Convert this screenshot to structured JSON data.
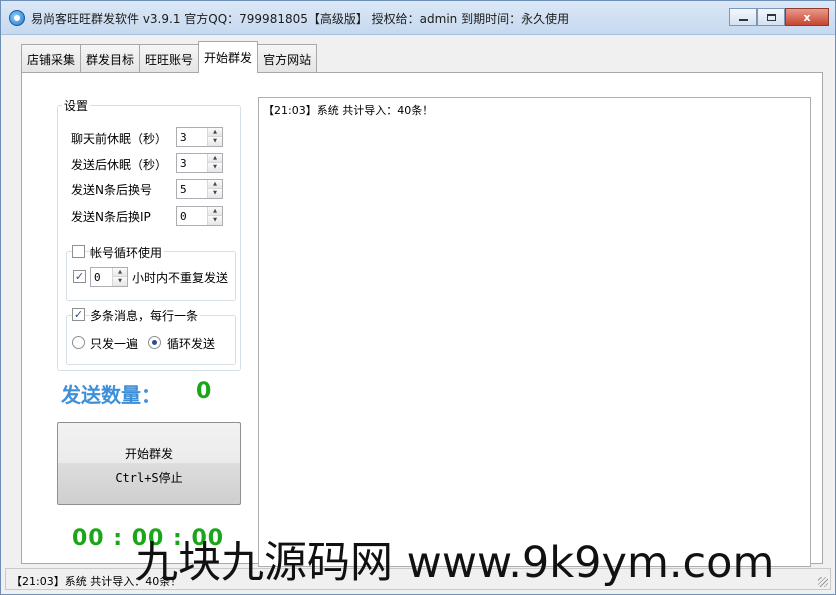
{
  "window": {
    "title": "易尚客旺旺群发软件 v3.9.1 官方QQ：799981805【高级版】 授权给：admin  到期时间：永久使用",
    "buttons": {
      "close": "x"
    }
  },
  "tabs": [
    {
      "label": "店铺采集"
    },
    {
      "label": "群发目标"
    },
    {
      "label": "旺旺账号"
    },
    {
      "label": "开始群发"
    },
    {
      "label": "官方网站"
    }
  ],
  "settings": {
    "title": "设置",
    "fields": [
      {
        "label": "聊天前休眠（秒）",
        "value": "3"
      },
      {
        "label": "发送后休眠（秒）",
        "value": "3"
      },
      {
        "label": "发送N条后换号",
        "value": "5"
      },
      {
        "label": "发送N条后换IP",
        "value": "0"
      }
    ],
    "account_loop": {
      "label": "帐号循环使用",
      "checked": false,
      "no_repeat": {
        "checked": true,
        "hours": "0",
        "label": "小时内不重复发送"
      }
    },
    "multi_message": {
      "label": "多条消息，每行一条",
      "checked": true,
      "options": [
        {
          "label": "只发一遍",
          "selected": false
        },
        {
          "label": "循环发送",
          "selected": true
        }
      ]
    }
  },
  "counter": {
    "label": "发送数量：",
    "value": "0"
  },
  "start_button": {
    "line1": "开始群发",
    "line2": "Ctrl+S停止"
  },
  "timer": "00 : 00 : 00",
  "log": [
    "【21:03】系统 共计导入：40条！"
  ],
  "status": "【21:03】系统 共计导入：40条！",
  "watermark": "九块九源码网 www.9k9ym.com",
  "colors": {
    "counter_label": "#3d8fd8",
    "counter_value": "#1aa51a",
    "timer": "#1aa51a"
  }
}
